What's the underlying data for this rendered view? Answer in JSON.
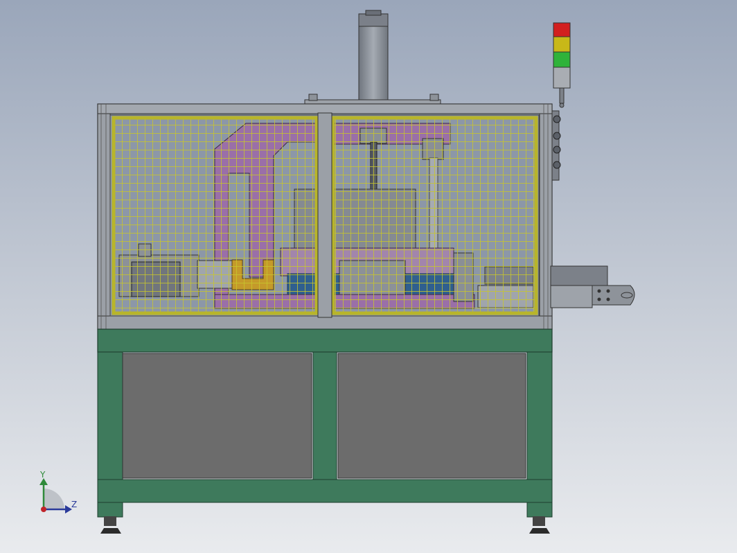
{
  "scene": {
    "background_top": "#9aa6ba",
    "background_bottom": "#e9ebee",
    "colors": {
      "frame_green": "#3e7a5c",
      "panel_gray": "#6c6c6c",
      "aluminum": "#8b9098",
      "mesh_yellow": "#c7c62a",
      "mechanism_purple": "#9a6fa8",
      "conveyor_blue": "#2f5f8f",
      "light_red": "#d21f1f",
      "light_yellow": "#c8b818",
      "light_green": "#2fb33a",
      "light_gray": "#a9adb3"
    },
    "icons": {
      "view_triad": "axis-triad-icon",
      "signal_tower": "stack-light-icon"
    }
  },
  "triad": {
    "y_label": "Y",
    "z_label": "Z"
  }
}
